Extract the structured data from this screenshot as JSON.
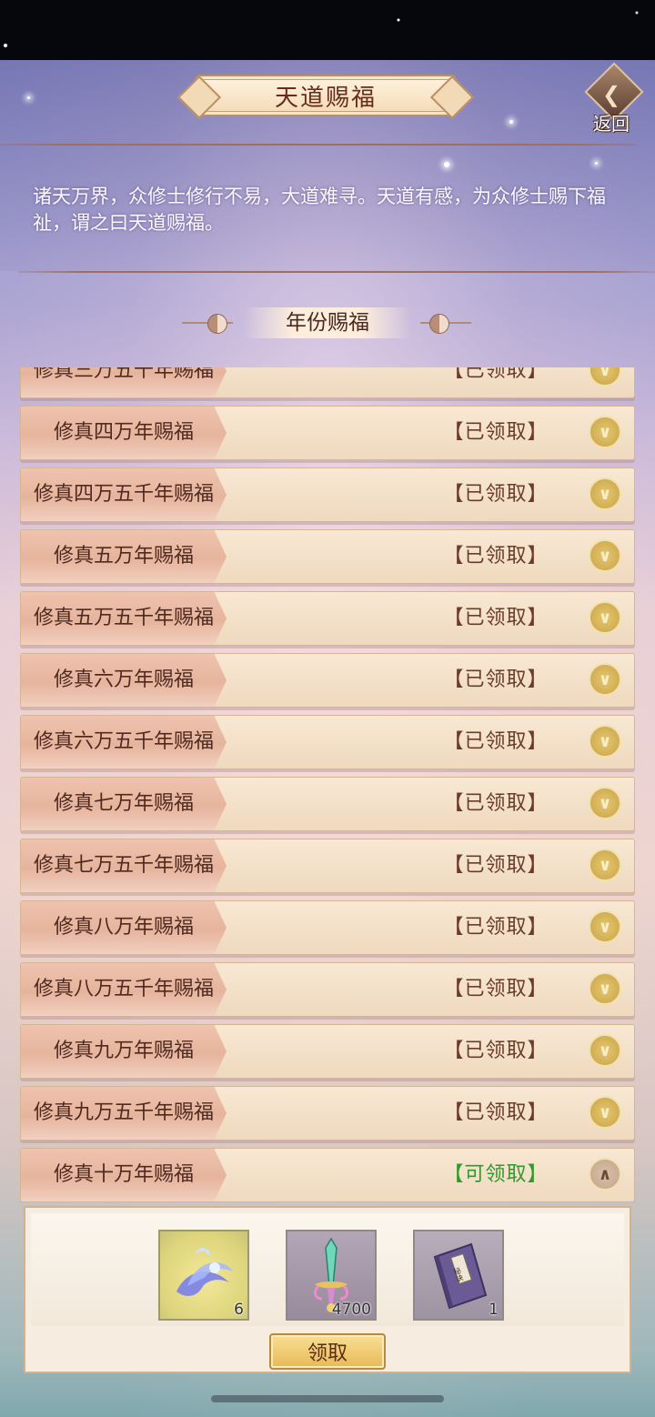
{
  "header": {
    "title": "天道赐福",
    "back_label": "返回"
  },
  "intro": {
    "text": "诸天万界，众修士修行不易，大道难寻。天道有感，为众修士赐下福祉，谓之曰天道赐福。"
  },
  "section": {
    "title": "年份赐福"
  },
  "rows": [
    {
      "name": "修真三万五千年赐福",
      "status": "【已领取】",
      "state": "claimed"
    },
    {
      "name": "修真四万年赐福",
      "status": "【已领取】",
      "state": "claimed"
    },
    {
      "name": "修真四万五千年赐福",
      "status": "【已领取】",
      "state": "claimed"
    },
    {
      "name": "修真五万年赐福",
      "status": "【已领取】",
      "state": "claimed"
    },
    {
      "name": "修真五万五千年赐福",
      "status": "【已领取】",
      "state": "claimed"
    },
    {
      "name": "修真六万年赐福",
      "status": "【已领取】",
      "state": "claimed"
    },
    {
      "name": "修真六万五千年赐福",
      "status": "【已领取】",
      "state": "claimed"
    },
    {
      "name": "修真七万年赐福",
      "status": "【已领取】",
      "state": "claimed"
    },
    {
      "name": "修真七万五千年赐福",
      "status": "【已领取】",
      "state": "claimed"
    },
    {
      "name": "修真八万年赐福",
      "status": "【已领取】",
      "state": "claimed"
    },
    {
      "name": "修真八万五千年赐福",
      "status": "【已领取】",
      "state": "claimed"
    },
    {
      "name": "修真九万年赐福",
      "status": "【已领取】",
      "state": "claimed"
    },
    {
      "name": "修真九万五千年赐福",
      "status": "【已领取】",
      "state": "claimed"
    },
    {
      "name": "修真十万年赐福",
      "status": "【可领取】",
      "state": "available"
    }
  ],
  "rewards": {
    "items": [
      {
        "icon": "water-spirit-icon",
        "count": "6"
      },
      {
        "icon": "sword-icon",
        "count": "4700"
      },
      {
        "icon": "manual-book-icon",
        "count": "1",
        "book_label": "秘诀"
      }
    ],
    "claim_label": "领取"
  },
  "colors": {
    "claimed_status": "#6a3c2c",
    "available_status": "#2f9b2a",
    "accent_gold": "#e6b956"
  }
}
